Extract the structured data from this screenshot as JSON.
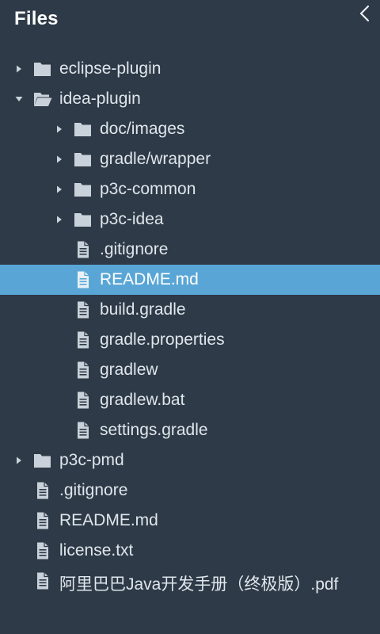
{
  "header": {
    "title": "Files",
    "collapse_icon": "chevron-left-icon"
  },
  "colors": {
    "background": "#2e3a47",
    "selected": "#59a6d6",
    "icon": "#c9d2da",
    "text": "#dfe6ec"
  },
  "tree": [
    {
      "label": "eclipse-plugin",
      "type": "folder",
      "expanded": false,
      "depth": 0,
      "selected": false
    },
    {
      "label": "idea-plugin",
      "type": "folder",
      "expanded": true,
      "depth": 0,
      "selected": false
    },
    {
      "label": "doc/images",
      "type": "folder",
      "expanded": false,
      "depth": 1,
      "selected": false
    },
    {
      "label": "gradle/wrapper",
      "type": "folder",
      "expanded": false,
      "depth": 1,
      "selected": false
    },
    {
      "label": "p3c-common",
      "type": "folder",
      "expanded": false,
      "depth": 1,
      "selected": false
    },
    {
      "label": "p3c-idea",
      "type": "folder",
      "expanded": false,
      "depth": 1,
      "selected": false
    },
    {
      "label": ".gitignore",
      "type": "file",
      "depth": 1,
      "selected": false
    },
    {
      "label": "README.md",
      "type": "file",
      "depth": 1,
      "selected": true
    },
    {
      "label": "build.gradle",
      "type": "file",
      "depth": 1,
      "selected": false
    },
    {
      "label": "gradle.properties",
      "type": "file",
      "depth": 1,
      "selected": false
    },
    {
      "label": "gradlew",
      "type": "file",
      "depth": 1,
      "selected": false
    },
    {
      "label": "gradlew.bat",
      "type": "file",
      "depth": 1,
      "selected": false
    },
    {
      "label": "settings.gradle",
      "type": "file",
      "depth": 1,
      "selected": false
    },
    {
      "label": "p3c-pmd",
      "type": "folder",
      "expanded": false,
      "depth": 0,
      "selected": false
    },
    {
      "label": ".gitignore",
      "type": "file",
      "depth": 0,
      "selected": false
    },
    {
      "label": "README.md",
      "type": "file",
      "depth": 0,
      "selected": false
    },
    {
      "label": "license.txt",
      "type": "file",
      "depth": 0,
      "selected": false
    },
    {
      "label": "阿里巴巴Java开发手册（终极版）.pdf",
      "type": "file",
      "depth": 0,
      "selected": false
    }
  ]
}
